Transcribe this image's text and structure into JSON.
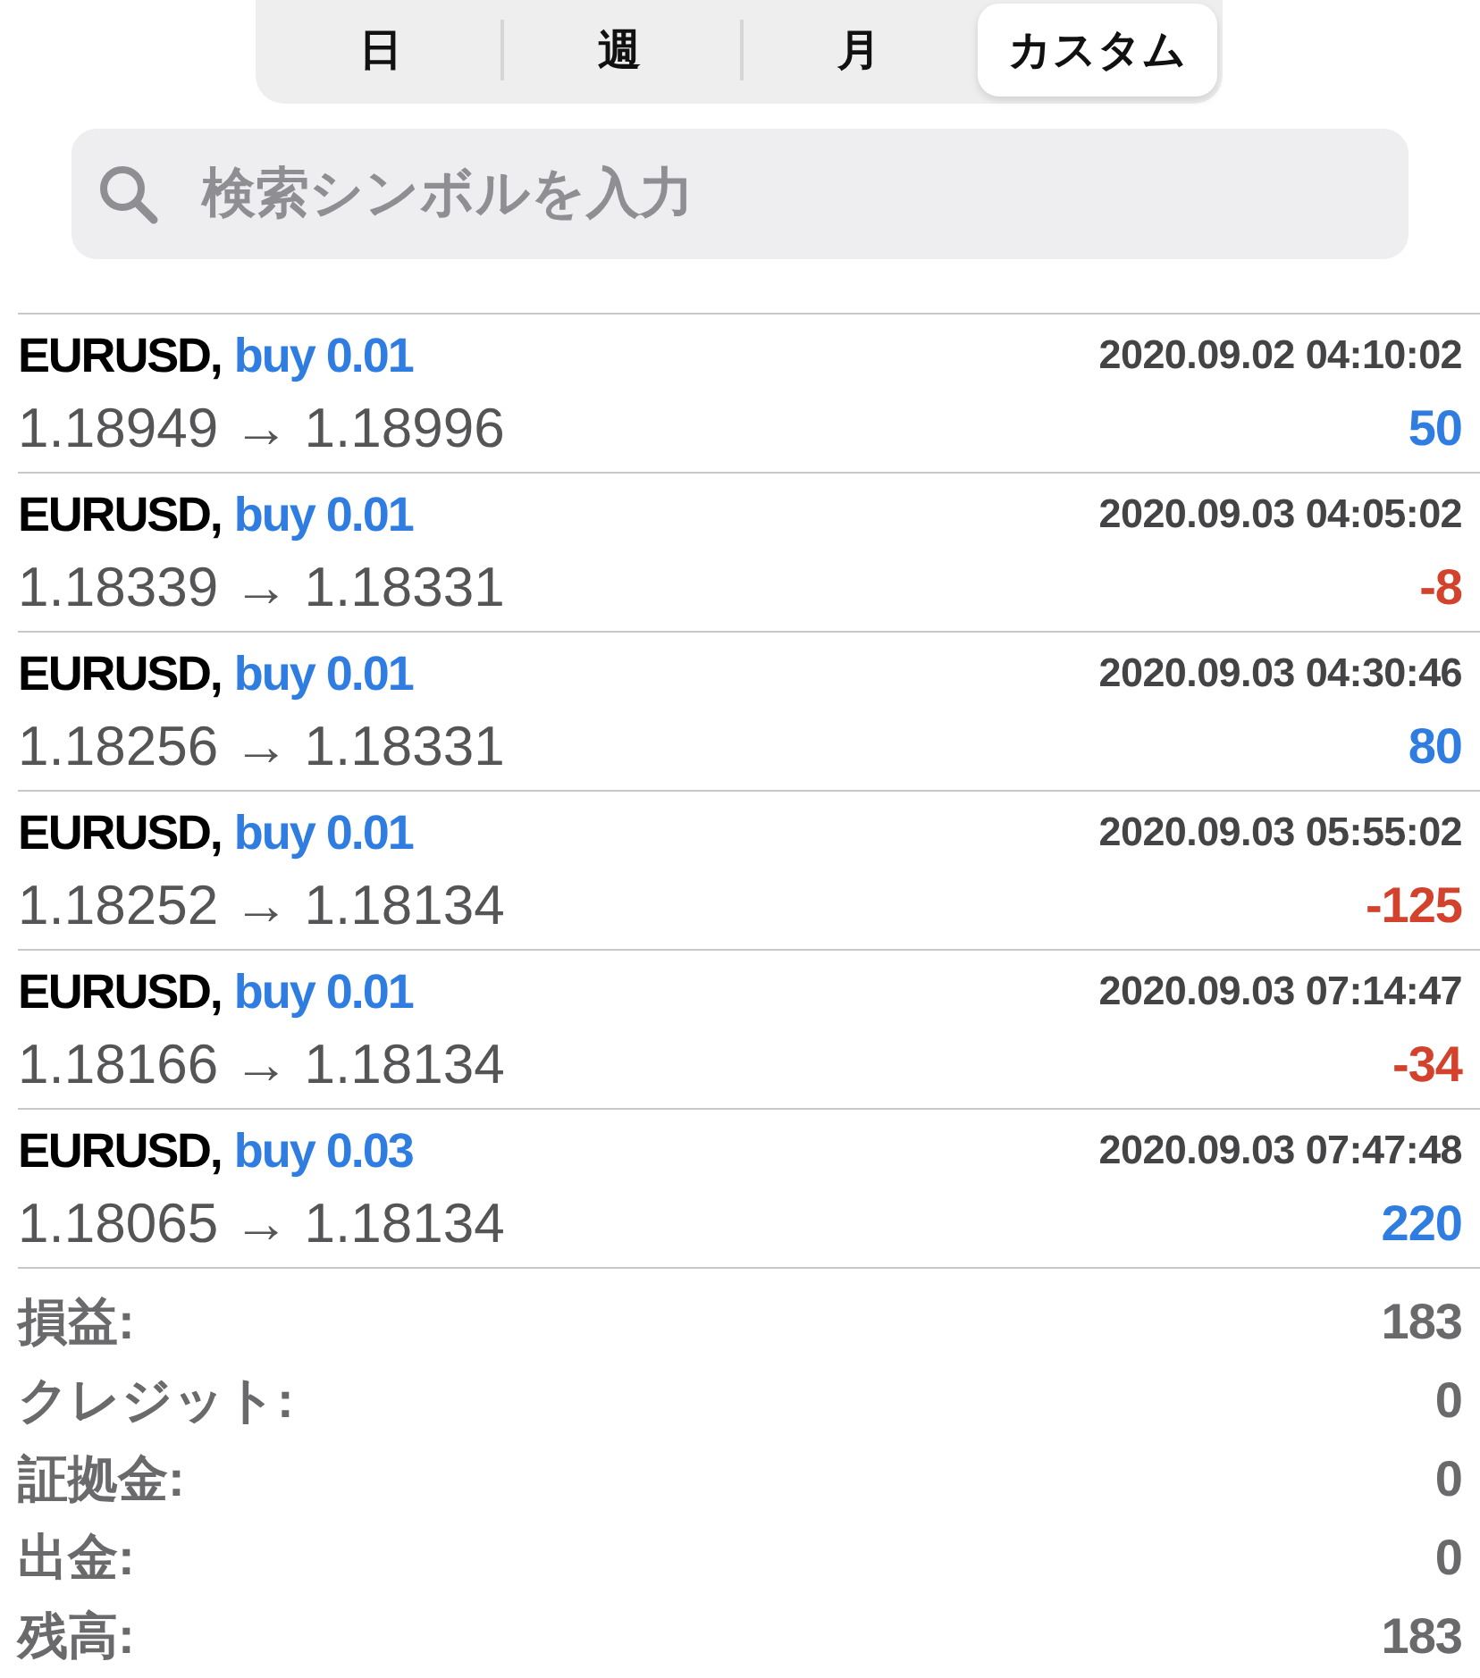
{
  "tabs": [
    {
      "label": "日",
      "selected": false
    },
    {
      "label": "週",
      "selected": false
    },
    {
      "label": "月",
      "selected": false
    },
    {
      "label": "カスタム",
      "selected": true
    }
  ],
  "search": {
    "placeholder": "検索シンボルを入力"
  },
  "trades": [
    {
      "symbol": "EURUSD,",
      "order": "buy 0.01",
      "time": "2020.09.02 04:10:02",
      "prices": "1.18949 → 1.18996",
      "profit": "50",
      "color": "#2f7de1"
    },
    {
      "symbol": "EURUSD,",
      "order": "buy 0.01",
      "time": "2020.09.03 04:05:02",
      "prices": "1.18339 → 1.18331",
      "profit": "-8",
      "color": "#d2422c"
    },
    {
      "symbol": "EURUSD,",
      "order": "buy 0.01",
      "time": "2020.09.03 04:30:46",
      "prices": "1.18256 → 1.18331",
      "profit": "80",
      "color": "#2f7de1"
    },
    {
      "symbol": "EURUSD,",
      "order": "buy 0.01",
      "time": "2020.09.03 05:55:02",
      "prices": "1.18252 → 1.18134",
      "profit": "-125",
      "color": "#d2422c"
    },
    {
      "symbol": "EURUSD,",
      "order": "buy 0.01",
      "time": "2020.09.03 07:14:47",
      "prices": "1.18166 → 1.18134",
      "profit": "-34",
      "color": "#d2422c"
    },
    {
      "symbol": "EURUSD,",
      "order": "buy 0.03",
      "time": "2020.09.03 07:47:48",
      "prices": "1.18065 → 1.18134",
      "profit": "220",
      "color": "#2f7de1"
    }
  ],
  "summary": [
    {
      "label": "損益:",
      "value": "183"
    },
    {
      "label": "クレジット:",
      "value": "0"
    },
    {
      "label": "証拠金:",
      "value": "0"
    },
    {
      "label": "出金:",
      "value": "0"
    },
    {
      "label": "残高:",
      "value": "183"
    }
  ]
}
